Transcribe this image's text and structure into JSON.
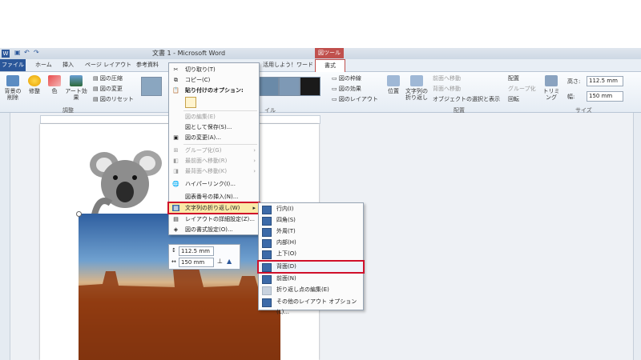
{
  "app": {
    "title": "文書 1 - Microsoft Word",
    "tools_tab": "図ツール"
  },
  "tabs": [
    "ファイル",
    "ホーム",
    "挿入",
    "ページ レイアウト",
    "参考資料",
    "活用しよう！ワード",
    "書式"
  ],
  "ribbon": {
    "adjust": {
      "buttons": [
        "背景の削除",
        "修整",
        "色",
        "アート効果"
      ],
      "small": [
        "図の圧縮",
        "図の変更",
        "図のリセット"
      ],
      "label": "調整"
    },
    "styles": {
      "small": [
        "図の枠線",
        "図の効果",
        "図のレイアウト"
      ],
      "label": "イル"
    },
    "arrange": {
      "buttons": [
        "位置",
        "文字列の折り返し"
      ],
      "small": [
        "前面へ移動",
        "背面へ移動",
        "オブジェクトの選択と表示",
        "配置",
        "グループ化",
        "回転"
      ],
      "label": "配置"
    },
    "size": {
      "crop": "トリミング",
      "height_label": "高さ:",
      "height_value": "112.5 mm",
      "width_label": "幅:",
      "width_value": "150 mm",
      "label": "サイズ"
    }
  },
  "mini_toolbar": {
    "height": "112.5 mm",
    "width": "150 mm"
  },
  "context_menu": {
    "items": [
      {
        "label": "切り取り(T)",
        "icon": "cut-icon",
        "enabled": true
      },
      {
        "label": "コピー(C)",
        "icon": "copy-icon",
        "enabled": true
      },
      {
        "label": "貼り付けのオプション:",
        "icon": "paste-icon",
        "enabled": true
      },
      {
        "label": "図の編集(E)",
        "icon": "",
        "enabled": false
      },
      {
        "label": "図として保存(S)...",
        "icon": "",
        "enabled": true
      },
      {
        "label": "図の変更(A)...",
        "icon": "change-picture-icon",
        "enabled": true
      },
      {
        "label": "グループ化(G)",
        "icon": "group-icon",
        "enabled": false
      },
      {
        "label": "最前面へ移動(R)",
        "icon": "bring-front-icon",
        "enabled": false
      },
      {
        "label": "最背面へ移動(K)",
        "icon": "send-back-icon",
        "enabled": false
      },
      {
        "label": "ハイパーリンク(I)...",
        "icon": "hyperlink-icon",
        "enabled": true
      },
      {
        "label": "図表番号の挿入(N)...",
        "icon": "",
        "enabled": true
      },
      {
        "label": "文字列の折り返し(W)",
        "icon": "wrap-text-icon",
        "enabled": true
      },
      {
        "label": "レイアウトの詳細設定(Z)...",
        "icon": "layout-icon",
        "enabled": true
      },
      {
        "label": "図の書式設定(O)...",
        "icon": "format-picture-icon",
        "enabled": true
      }
    ]
  },
  "wrap_submenu": {
    "items": [
      {
        "label": "行内(I)",
        "enabled": true
      },
      {
        "label": "四角(S)",
        "enabled": true
      },
      {
        "label": "外周(T)",
        "enabled": true
      },
      {
        "label": "内部(H)",
        "enabled": true
      },
      {
        "label": "上下(O)",
        "enabled": true
      },
      {
        "label": "背面(D)",
        "enabled": true
      },
      {
        "label": "前面(N)",
        "enabled": true
      },
      {
        "label": "折り返し点の編集(E)",
        "enabled": false
      },
      {
        "label": "その他のレイアウト オプション(L)...",
        "enabled": true
      }
    ]
  },
  "colors": {
    "accent_red": "#d0102a",
    "file_tab": "#2b579a",
    "tools_tab": "#c0504d",
    "highlight": "#fbe9a7"
  }
}
